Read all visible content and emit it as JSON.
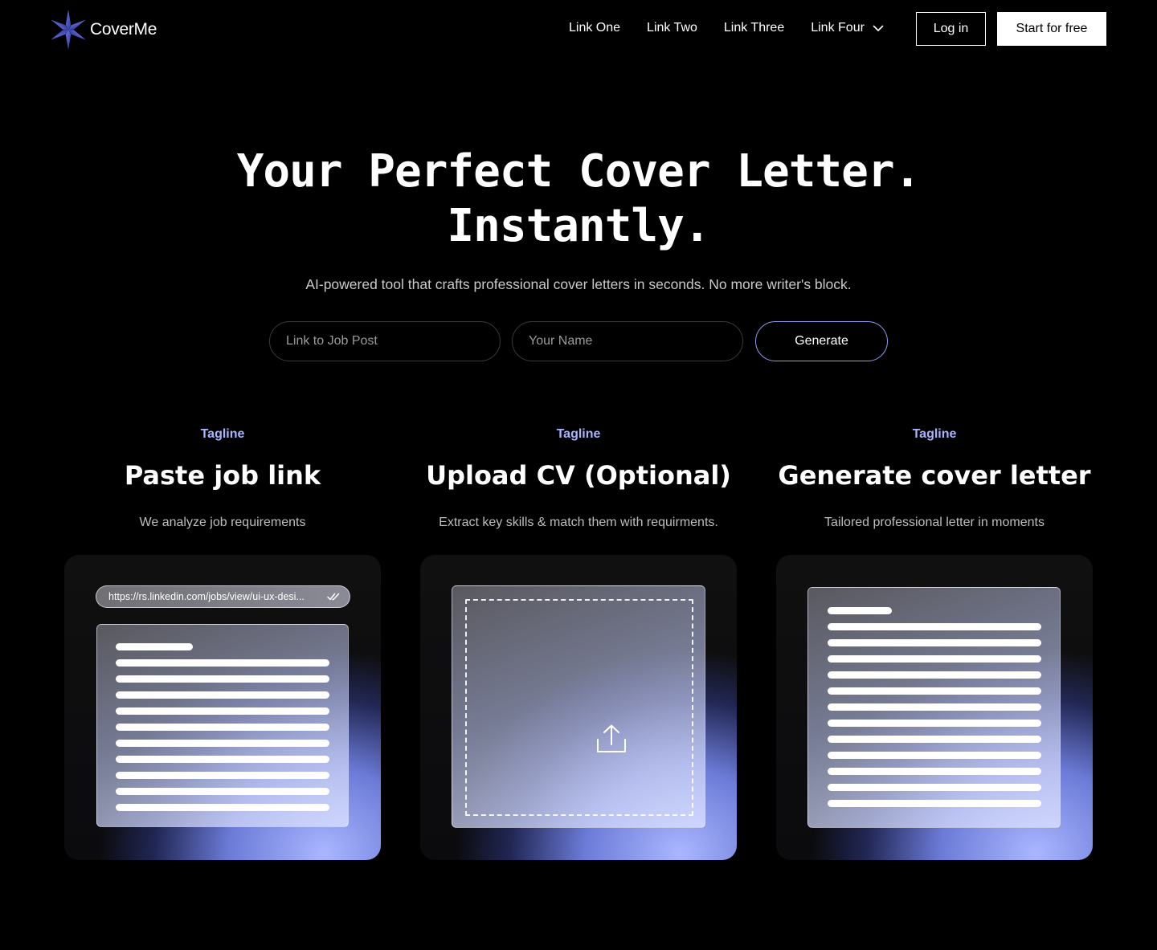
{
  "brand": {
    "name": "CoverMe",
    "icon": "star-logo-icon",
    "color": "#4a55c8"
  },
  "nav": {
    "links": [
      "Link One",
      "Link Two",
      "Link Three",
      "Link Four"
    ],
    "dropdown_icon": "chevron-down-icon",
    "login_label": "Log in",
    "start_label": "Start for free"
  },
  "hero": {
    "title_line1": "Your Perfect Cover Letter.",
    "title_line2": "Instantly.",
    "subtitle": "AI-powered tool that crafts professional cover letters in seconds. No more writer's block.",
    "job_placeholder": "Link to Job Post",
    "name_placeholder": "Your Name",
    "generate_label": "Generate"
  },
  "features": [
    {
      "tagline": "Tagline",
      "title": "Paste job link",
      "description": "We analyze job requirements"
    },
    {
      "tagline": "Tagline",
      "title": "Upload CV (Optional)",
      "description": "Extract key skills & match them with requirments."
    },
    {
      "tagline": "Tagline",
      "title": "Generate cover letter",
      "description": "Tailored professional letter in moments"
    }
  ],
  "cards": {
    "url": "https://rs.linkedin.com/jobs/view/ui-ux-desi...",
    "url_icon": "double-check-icon",
    "upload_icon": "upload-icon"
  },
  "colors": {
    "accent": "#a9b4ff",
    "glow": "#7c8efa",
    "background": "#000000"
  }
}
